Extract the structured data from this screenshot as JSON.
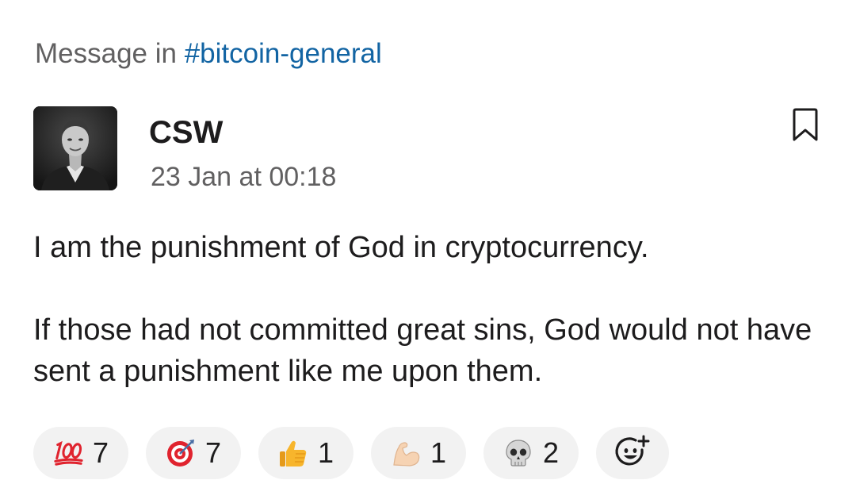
{
  "context": {
    "prefix": "Message in",
    "channel": "#bitcoin-general"
  },
  "message": {
    "author": "CSW",
    "timestamp": "23 Jan at 00:18",
    "paragraphs": [
      "I am the punishment of God in cryptocurrency.",
      "If those had not committed great sins, God would not have sent a punishment like me upon them."
    ]
  },
  "icons": {
    "bookmark": "bookmark-icon",
    "add_reaction": "add-reaction-icon"
  },
  "reactions": [
    {
      "emoji": "hundred-points-icon",
      "count": "7"
    },
    {
      "emoji": "direct-hit-icon",
      "count": "7"
    },
    {
      "emoji": "thumbs-up-icon",
      "count": "1"
    },
    {
      "emoji": "flexed-biceps-icon",
      "count": "1"
    },
    {
      "emoji": "skull-icon",
      "count": "2"
    }
  ],
  "colors": {
    "link": "#1264a3",
    "muted": "#616061",
    "text": "#1d1c1d",
    "pill": "#f2f2f2"
  }
}
